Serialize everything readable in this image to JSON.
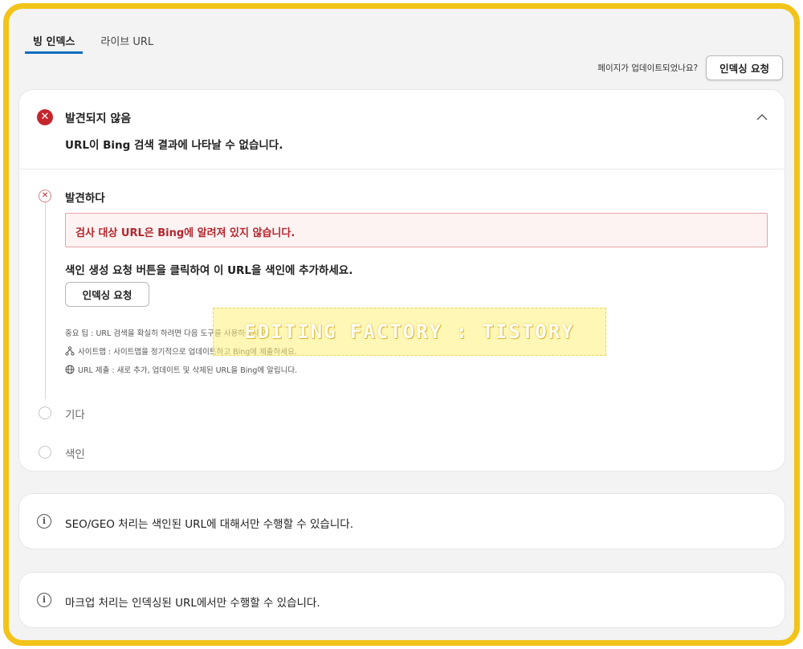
{
  "tabs": [
    {
      "label": "빙 인덱스",
      "active": true
    },
    {
      "label": "라이브 URL",
      "active": false
    }
  ],
  "update": {
    "question": "페이지가 업데이트되었나요?",
    "request_button": "인덱싱 요청"
  },
  "status": {
    "title": "발견되지 않음",
    "subtitle": "URL이 Bing 검색 결과에 나타날 수 없습니다."
  },
  "steps": [
    {
      "label": "발견하다",
      "state": "error"
    },
    {
      "label": "기다",
      "state": "pending"
    },
    {
      "label": "색인",
      "state": "pending"
    }
  ],
  "alert": {
    "message": "검사 대상 URL은 Bing에 알려져 있지 않습니다."
  },
  "instruction": "색인 생성 요청 버튼을 클릭하여 이 URL을 색인에 추가하세요.",
  "inner_button": "인덱싱 요청",
  "tips": [
    {
      "icon": "none",
      "text": "중요 팁 : URL 검색을 확실히 하려면 다음 도구를 사용하십시오."
    },
    {
      "icon": "sitemap-icon",
      "text": "사이트맵 : 사이트맵을 정기적으로 업데이트하고 Bing에 제출하세요."
    },
    {
      "icon": "globe-icon",
      "text": "URL 제출 : 새로 추가, 업데이트 및 삭제된 URL을 Bing에 알립니다."
    }
  ],
  "watermark": "EDITING FACTORY : TISTORY",
  "info": [
    {
      "text": "SEO/GEO 처리는 색인된 URL에 대해서만 수행할 수 있습니다."
    },
    {
      "text": "마크업 처리는 인덱싱된 URL에서만 수행할 수 있습니다."
    }
  ],
  "colors": {
    "frame": "#f2c318",
    "accent": "#0f6cbd",
    "error": "#c4262e"
  }
}
